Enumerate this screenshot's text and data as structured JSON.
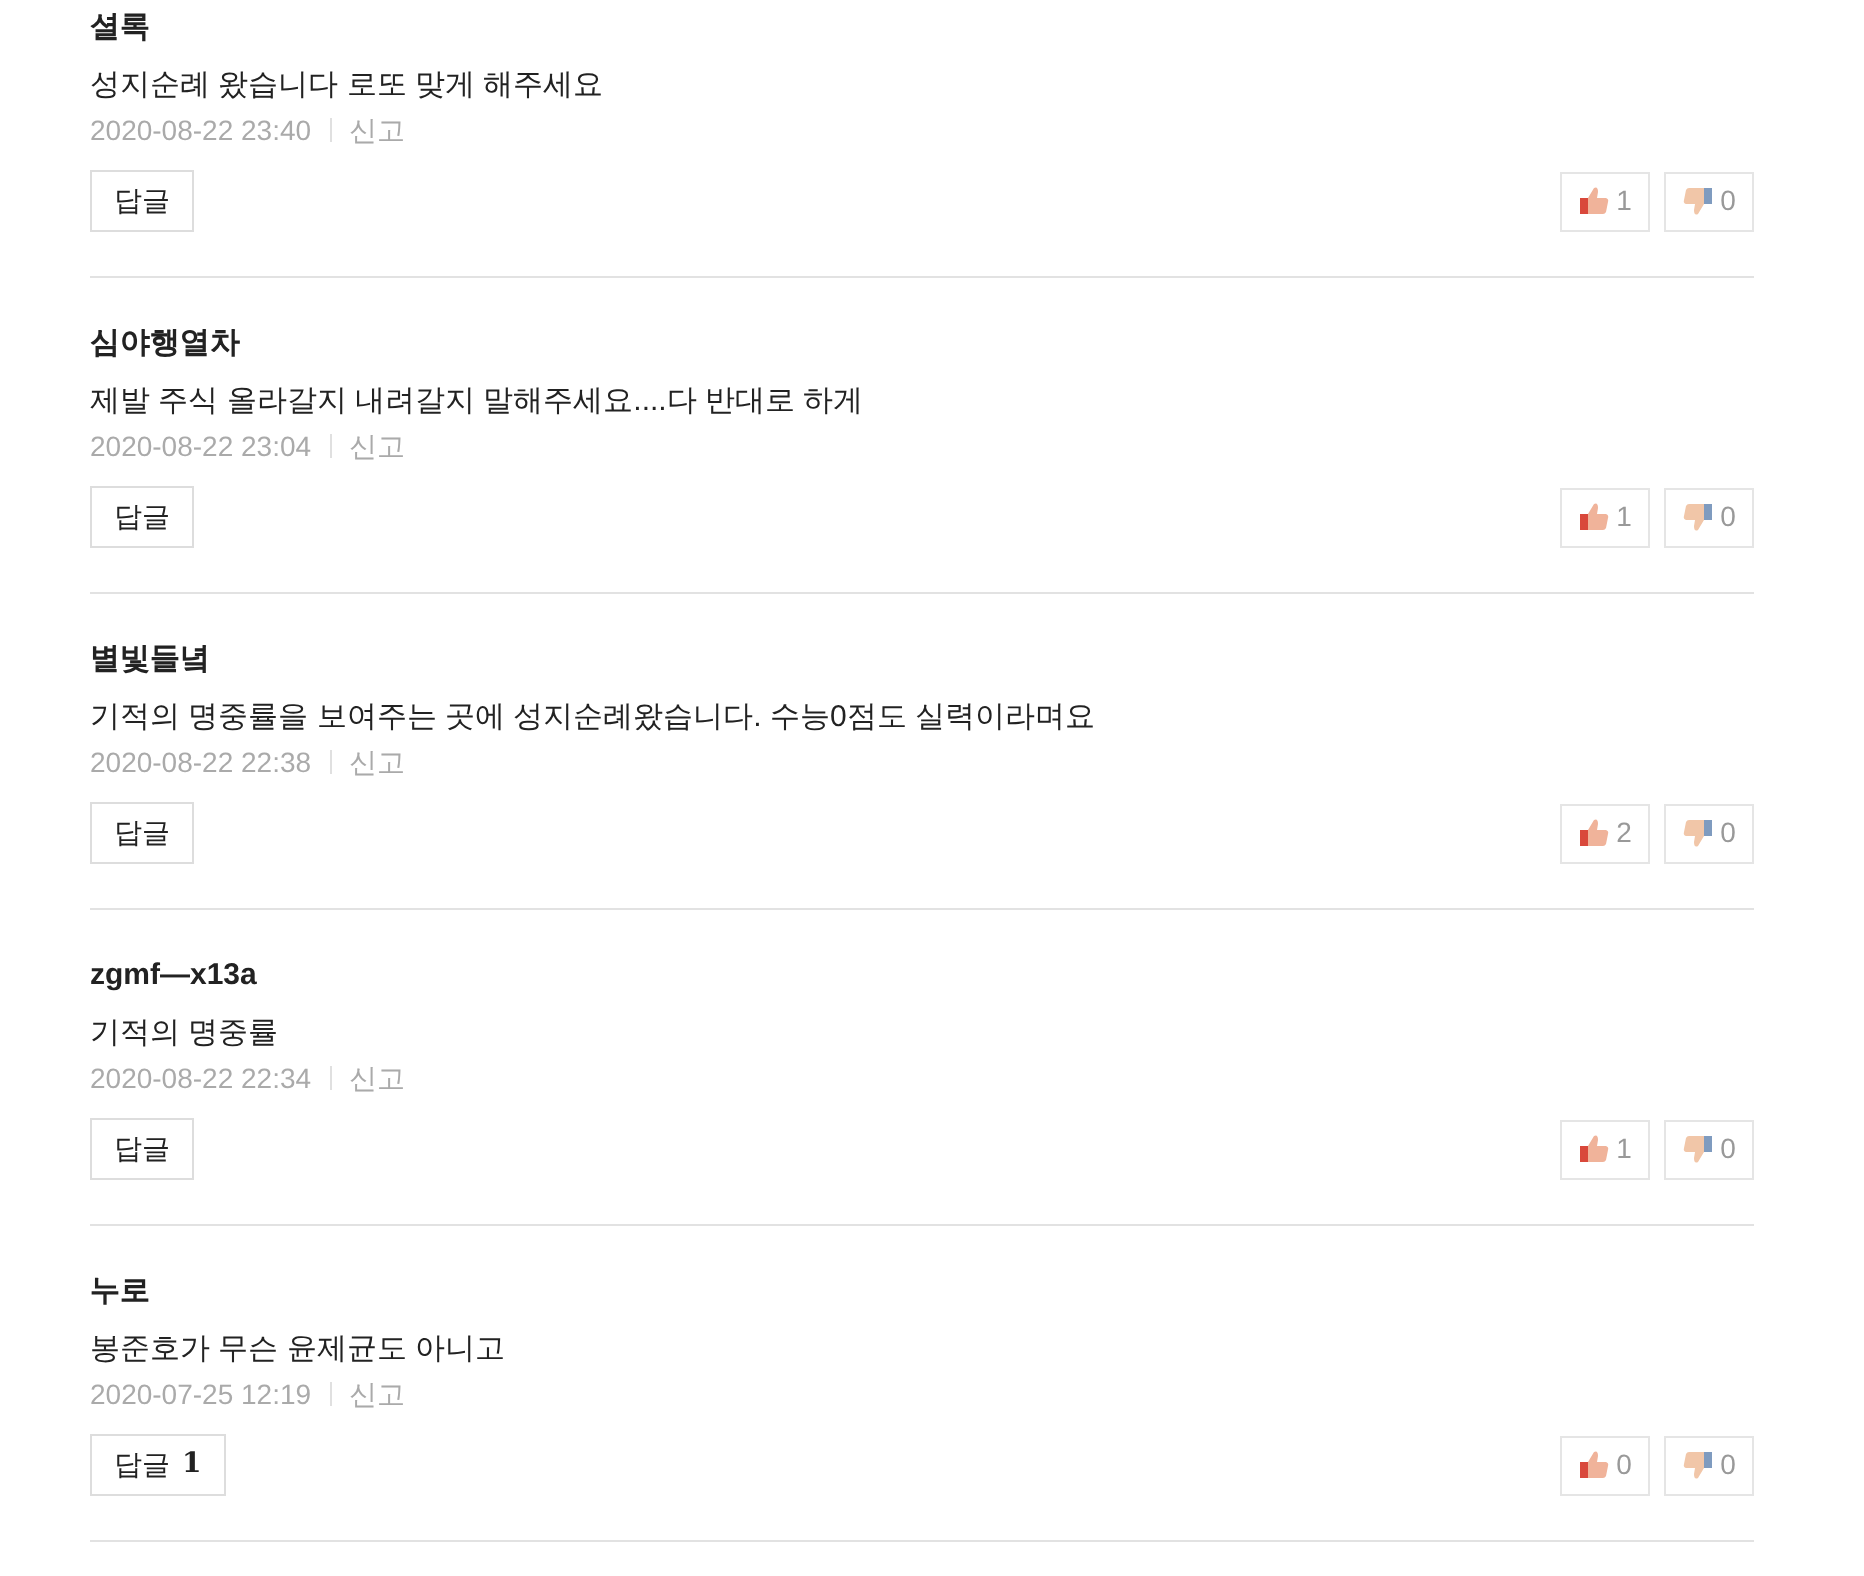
{
  "comments": [
    {
      "author": "셜록",
      "text": "성지순례 왔습니다 로또 맞게 해주세요",
      "date": "2020-08-22 23:40",
      "report": "신고",
      "reply": {
        "label": "답글"
      },
      "likes": "1",
      "dislikes": "0"
    },
    {
      "author": "심야행열차",
      "text": "제발 주식 올라갈지 내려갈지 말해주세요....다 반대로 하게",
      "date": "2020-08-22 23:04",
      "report": "신고",
      "reply": {
        "label": "답글"
      },
      "likes": "1",
      "dislikes": "0"
    },
    {
      "author": "별빛들녘",
      "text": "기적의 명중률을 보여주는 곳에 성지순례왔습니다. 수능0점도 실력이라며요",
      "date": "2020-08-22 22:38",
      "report": "신고",
      "reply": {
        "label": "답글"
      },
      "likes": "2",
      "dislikes": "0"
    },
    {
      "author": "zgmf—x13a",
      "text": "기적의 명중률",
      "date": "2020-08-22 22:34",
      "report": "신고",
      "reply": {
        "label": "답글"
      },
      "likes": "1",
      "dislikes": "0"
    },
    {
      "author": "누로",
      "text": "봉준호가 무슨 윤제균도 아니고",
      "date": "2020-07-25 12:19",
      "report": "신고",
      "reply": {
        "label": "답글",
        "count": "1"
      },
      "likes": "0",
      "dislikes": "0"
    }
  ]
}
